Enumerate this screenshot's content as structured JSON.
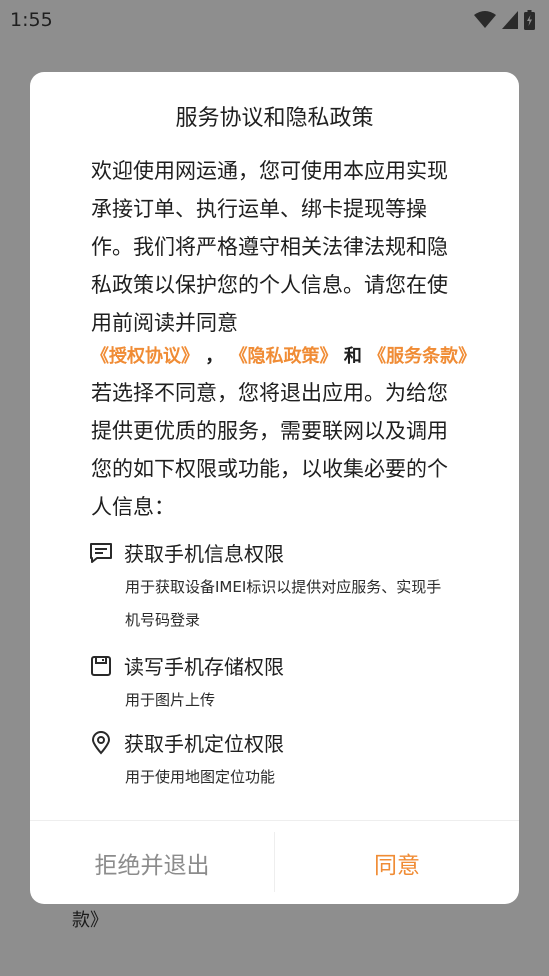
{
  "statusbar": {
    "time": "1:55"
  },
  "background": {
    "text": "款》"
  },
  "dialog": {
    "title": "服务协议和隐私政策",
    "intro": "欢迎使用网运通，您可使用本应用实现承接订单、执行运单、绑卡提现等操作。我们将严格遵守相关法律法规和隐私政策以保护您的个人信息。请您在使用前阅读并同意",
    "links": {
      "auth": "《授权协议》",
      "sep1": "，",
      "privacy": "《隐私政策》",
      "and": "和",
      "service": "《服务条款》"
    },
    "body2": "若选择不同意，您将退出应用。为给您提供更优质的服务，需要联网以及调用您的如下权限或功能，以收集必要的个人信息：",
    "permissions": [
      {
        "icon": "message-icon",
        "title": "获取手机信息权限",
        "desc": "用于获取设备IMEI标识以提供对应服务、实现手机号码登录"
      },
      {
        "icon": "save-icon",
        "title": "读写手机存储权限",
        "desc": "用于图片上传"
      },
      {
        "icon": "location-icon",
        "title": "获取手机定位权限",
        "desc": "用于使用地图定位功能"
      }
    ],
    "buttons": {
      "reject": "拒绝并退出",
      "agree": "同意"
    }
  },
  "colors": {
    "accent": "#f08c35",
    "dim": "#8c8c8c"
  }
}
